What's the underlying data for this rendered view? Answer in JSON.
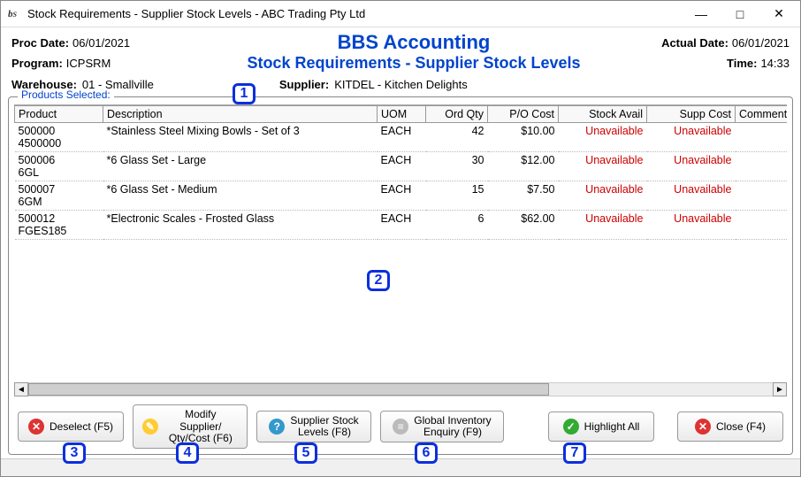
{
  "window": {
    "title": "Stock Requirements - Supplier Stock Levels - ABC Trading Pty Ltd"
  },
  "header": {
    "proc_date_label": "Proc Date:",
    "proc_date": "06/01/2021",
    "program_label": "Program:",
    "program": "ICPSRM",
    "actual_date_label": "Actual Date:",
    "actual_date": "06/01/2021",
    "time_label": "Time:",
    "time": "14:33",
    "main_title": "BBS Accounting",
    "sub_title": "Stock Requirements - Supplier Stock Levels"
  },
  "info": {
    "warehouse_label": "Warehouse:",
    "warehouse": "01 - Smallville",
    "supplier_label": "Supplier:",
    "supplier": "KITDEL - Kitchen Delights"
  },
  "groupbox_title": "Products Selected:",
  "columns": {
    "product": "Product",
    "description": "Description",
    "uom": "UOM",
    "ord_qty": "Ord Qty",
    "po_cost": "P/O Cost",
    "stock_avail": "Stock Avail",
    "supp_cost": "Supp Cost",
    "comments": "Comments"
  },
  "rows": [
    {
      "product": "500000",
      "product2": "4500000",
      "desc": "*Stainless Steel Mixing Bowls - Set of 3",
      "uom": "EACH",
      "qty": "42",
      "po": "$10.00",
      "avail": "Unavailable",
      "supp": "Unavailable",
      "comments": ""
    },
    {
      "product": "500006",
      "product2": "6GL",
      "desc": "*6 Glass Set - Large",
      "uom": "EACH",
      "qty": "30",
      "po": "$12.00",
      "avail": "Unavailable",
      "supp": "Unavailable",
      "comments": ""
    },
    {
      "product": "500007",
      "product2": "6GM",
      "desc": "*6 Glass Set - Medium",
      "uom": "EACH",
      "qty": "15",
      "po": "$7.50",
      "avail": "Unavailable",
      "supp": "Unavailable",
      "comments": ""
    },
    {
      "product": "500012",
      "product2": "FGES185",
      "desc": "*Electronic Scales - Frosted Glass",
      "uom": "EACH",
      "qty": "6",
      "po": "$62.00",
      "avail": "Unavailable",
      "supp": "Unavailable",
      "comments": ""
    }
  ],
  "buttons": {
    "deselect": "Deselect (F5)",
    "modify": "Modify Supplier/\nQty/Cost (F6)",
    "supp_stock": "Supplier Stock\nLevels (F8)",
    "global_inv": "Global Inventory\nEnquiry (F9)",
    "highlight": "Highlight All",
    "close": "Close (F4)"
  },
  "callouts": [
    "1",
    "2",
    "3",
    "4",
    "5",
    "6",
    "7"
  ]
}
